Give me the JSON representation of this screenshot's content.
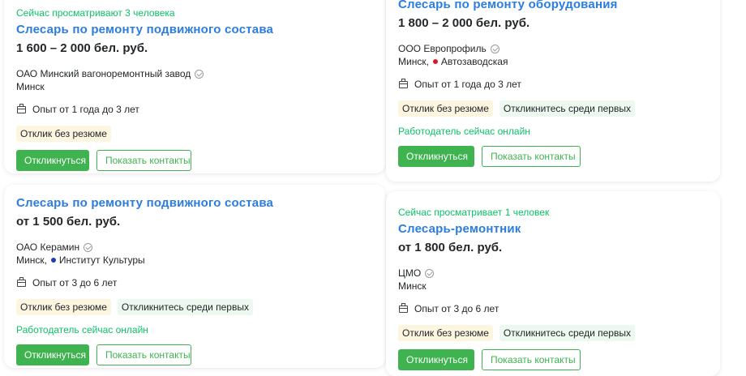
{
  "colors": {
    "title_link": "#2b7de0",
    "online_green": "#0dc267",
    "button_green": "#3eb34f",
    "tag_beige": "#fcf6e1",
    "tag_green": "#edf8ef"
  },
  "cards": [
    {
      "viewing": "Сейчас просматривают 3 человека",
      "title": "Слесарь по ремонту подвижного состава",
      "salary": "1 600 – 2 000 бел. руб.",
      "company": "ОАО Минский вагоноремонтный завод",
      "city": "Минск",
      "experience": "Опыт от 1 года до 3 лет",
      "tags": [
        "Отклик без резюме"
      ],
      "respond_label": "Откликнуться",
      "contacts_label": "Показать контакты"
    },
    {
      "title": "Слесарь по ремонту оборудования",
      "salary": "1 800 – 2 000 бел. руб.",
      "company": "ООО Европрофиль",
      "city": "Минск,",
      "metro": "Автозаводская",
      "metro_color": "#d6192c",
      "experience": "Опыт от 1 года до 3 лет",
      "tags": [
        "Отклик без резюме",
        "Откликнитесь среди первых"
      ],
      "online": "Работодатель сейчас онлайн",
      "respond_label": "Откликнуться",
      "contacts_label": "Показать контакты"
    },
    {
      "title": "Слесарь по ремонту подвижного состава",
      "salary": "от 1 500 бел. руб.",
      "company": "ОАО Керамин",
      "city": "Минск,",
      "metro": "Институт Культуры",
      "metro_color": "#1b3fb2",
      "experience": "Опыт от 3 до 6 лет",
      "tags": [
        "Отклик без резюме",
        "Откликнитесь среди первых"
      ],
      "online": "Работодатель сейчас онлайн",
      "respond_label": "Откликнуться",
      "contacts_label": "Показать контакты"
    },
    {
      "viewing": "Сейчас просматривает 1 человек",
      "title": "Слесарь-ремонтник",
      "salary": "от 1 800 бел. руб.",
      "company": "ЦМО",
      "city": "Минск",
      "experience": "Опыт от 3 до 6 лет",
      "tags": [
        "Отклик без резюме",
        "Откликнитесь среди первых"
      ],
      "respond_label": "Откликнуться",
      "contacts_label": "Показать контакты"
    }
  ]
}
